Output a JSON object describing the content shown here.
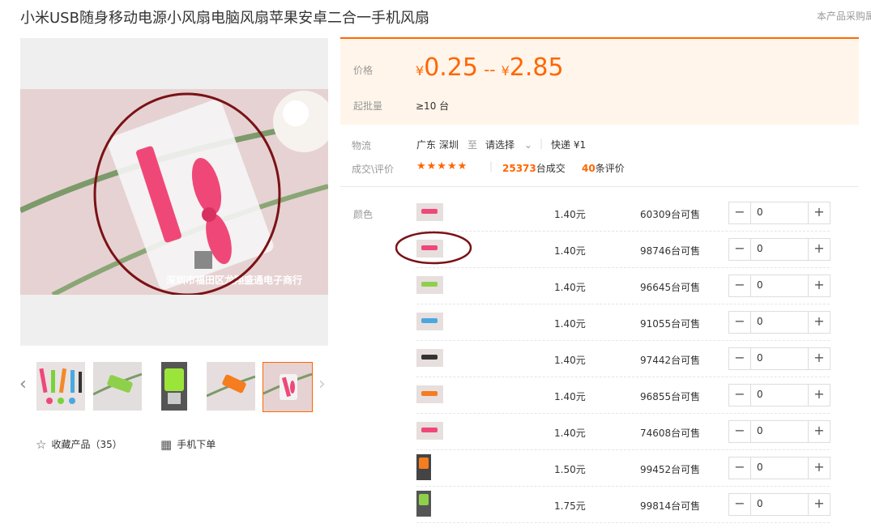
{
  "header": {
    "title": "小米USB随身移动电源小风扇电脑风扇苹果安卓二合一手机风扇",
    "side_note": "本产品采购属"
  },
  "gallery": {
    "watermark": "深圳市福田区龙翔盛通电子商行",
    "prev_icon": "chevron-left-icon",
    "next_icon": "chevron-right-icon",
    "thumb_count": 5,
    "selected_thumb": 5
  },
  "actions": {
    "favorite_label": "收藏产品（35）",
    "favorite_icon": "star-outline-icon",
    "mobile_label": "手机下单",
    "mobile_icon": "qr-code-icon"
  },
  "price": {
    "label": "价格",
    "currency": "¥",
    "low": "0.25",
    "separator": "--",
    "high": "2.85",
    "moq_label": "起批量",
    "moq_value": "≥10 台"
  },
  "logistics": {
    "label": "物流",
    "origin": "广东 深圳",
    "to": "至",
    "dest": "请选择",
    "express": "快递 ¥1"
  },
  "reviews": {
    "label": "成交\\评价",
    "stars": "★★★★★",
    "rating": 5,
    "sales_num": "25373",
    "sales_unit": "台成交",
    "review_num": "40",
    "review_unit": "条评价"
  },
  "sku": {
    "label": "颜色",
    "rows": [
      {
        "price": "1.40元",
        "stock": "60309台可售",
        "qty": "0"
      },
      {
        "price": "1.40元",
        "stock": "98746台可售",
        "qty": "0"
      },
      {
        "price": "1.40元",
        "stock": "96645台可售",
        "qty": "0"
      },
      {
        "price": "1.40元",
        "stock": "91055台可售",
        "qty": "0"
      },
      {
        "price": "1.40元",
        "stock": "97442台可售",
        "qty": "0"
      },
      {
        "price": "1.40元",
        "stock": "96855台可售",
        "qty": "0"
      },
      {
        "price": "1.40元",
        "stock": "74608台可售",
        "qty": "0"
      },
      {
        "price": "1.50元",
        "stock": "99452台可售",
        "qty": "0"
      },
      {
        "price": "1.75元",
        "stock": "99814台可售",
        "qty": "0"
      }
    ],
    "minus": "−",
    "plus": "+"
  },
  "colors": {
    "accent": "#ff6600",
    "price_bg": "#fff5ea",
    "annotation": "#7a1216"
  }
}
